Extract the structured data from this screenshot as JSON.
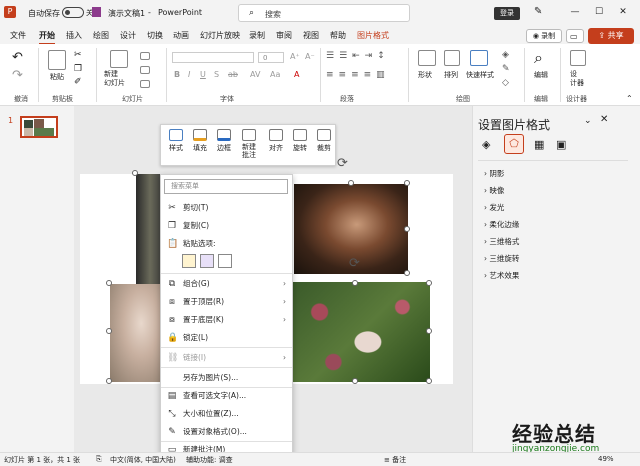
{
  "titlebar": {
    "autosave_label": "自动保存",
    "autosave_state": "关",
    "doc_title": "演示文稿1",
    "separator": "-",
    "app_name": "PowerPoint",
    "search_placeholder": "搜索",
    "login": "登录",
    "minimize": "—",
    "maximize": "☐",
    "close": "✕"
  },
  "menu": {
    "tabs": [
      "文件",
      "开始",
      "插入",
      "绘图",
      "设计",
      "切换",
      "动画",
      "幻灯片放映",
      "录制",
      "审阅",
      "视图",
      "帮助",
      "图片格式"
    ],
    "active": "开始",
    "record": "录制",
    "share": "共享"
  },
  "ribbon": {
    "groups": [
      "撤消",
      "剪贴板",
      "幻灯片",
      "字体",
      "段落",
      "绘图",
      "编辑",
      "设计器"
    ],
    "paste": "粘贴",
    "new_slide": "新建\n幻灯片",
    "shape": "形状",
    "arrange": "排列",
    "quick_style": "快速样式",
    "edit": "编辑",
    "designer": "设\n计器",
    "font_size": "0"
  },
  "slide_panel": {
    "slide_number": "1"
  },
  "mini_toolbar": {
    "items": [
      "样式",
      "填充",
      "边框",
      "新建\n批注",
      "对齐",
      "旋转",
      "裁剪"
    ]
  },
  "context_menu": {
    "search": "搜索菜单",
    "cut": "剪切(T)",
    "copy": "复制(C)",
    "paste_options": "粘贴选项:",
    "group": "组合(G)",
    "bring_front": "置于顶层(R)",
    "send_back": "置于底层(K)",
    "lock": "锁定(L)",
    "link": "链接(I)",
    "save_as_picture": "另存为图片(S)...",
    "alt_text": "查看可选文字(A)...",
    "size_position": "大小和位置(Z)...",
    "format_object": "设置对象格式(O)...",
    "new_comment": "新建批注(M)"
  },
  "format_panel": {
    "title": "设置图片格式",
    "close": "✕",
    "options": [
      "阴影",
      "映像",
      "发光",
      "柔化边缘",
      "三维格式",
      "三维旋转",
      "艺术效果"
    ]
  },
  "statusbar": {
    "slide_info": "幻灯片 第 1 张，共 1 张",
    "language": "中文(简体, 中国大陆)",
    "accessibility": "辅助功能: 调查",
    "notes": "备注",
    "zoom": "49%"
  },
  "watermark": {
    "text": "经验总结",
    "url": "jingyanzongjie.com"
  },
  "colors": {
    "accent": "#c43e1c"
  }
}
